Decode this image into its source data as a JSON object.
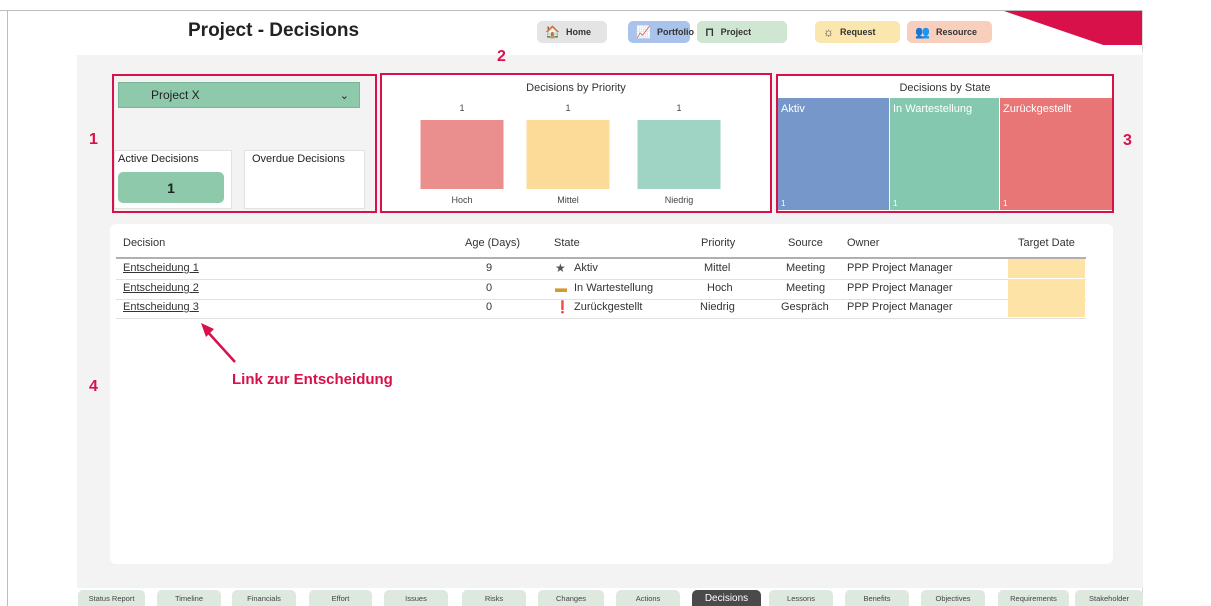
{
  "header": {
    "title": "Project - Decisions",
    "nav": [
      {
        "label": "Home",
        "icon": "home-icon",
        "glyph": "🏠",
        "color": "#e4e4e4"
      },
      {
        "label": "Portfolio",
        "icon": "portfolio-chart-icon",
        "glyph": "📈",
        "color": "#a9c3ec"
      },
      {
        "label": "Project",
        "icon": "gantt-icon",
        "glyph": "⊓",
        "color": "#cfe6d2"
      },
      {
        "label": "Request",
        "icon": "lightbulb-icon",
        "glyph": "☼",
        "color": "#fbe6ad"
      },
      {
        "label": "Resource",
        "icon": "people-icon",
        "glyph": "👥",
        "color": "#f8cfbd"
      }
    ],
    "accent_color": "#d8114a"
  },
  "annotations": {
    "numbers": [
      "1",
      "2",
      "3",
      "4"
    ],
    "link_note": "Link zur Entscheidung",
    "color": "#d8114a"
  },
  "filter": {
    "selected_project": "Project X",
    "chevron_icon": "chevron-down-icon"
  },
  "kpis": {
    "active_label": "Active Decisions",
    "active_value": "1",
    "overdue_label": "Overdue Decisions"
  },
  "priority_chart": {
    "title": "Decisions by Priority"
  },
  "chart_data": {
    "type": "bar",
    "title": "Decisions by Priority",
    "categories": [
      "Hoch",
      "Mittel",
      "Niedrig"
    ],
    "values": [
      1,
      1,
      1
    ],
    "colors": [
      "#ea8e8e",
      "#fcdb99",
      "#9fd3c3"
    ]
  },
  "state_chart": {
    "title": "Decisions by State",
    "states": [
      {
        "name": "Aktiv",
        "count": "1",
        "color": "#7597c9"
      },
      {
        "name": "In Wartestellung",
        "count": "1",
        "color": "#85c8b0"
      },
      {
        "name": "Zurückgestellt",
        "count": "1",
        "color": "#e87676"
      }
    ]
  },
  "table": {
    "headers": {
      "decision": "Decision",
      "age": "Age (Days)",
      "state": "State",
      "priority": "Priority",
      "source": "Source",
      "owner": "Owner",
      "target": "Target Date"
    },
    "rows": [
      {
        "decision": "Entscheidung 1",
        "age": "9",
        "state_icon": "star-icon",
        "state_glyph": "★",
        "state_color": "#555555",
        "state": "Aktiv",
        "priority": "Mittel",
        "source": "Meeting",
        "owner": "PPP Project Manager",
        "target": ""
      },
      {
        "decision": "Entscheidung 2",
        "age": "0",
        "state_icon": "dash-icon",
        "state_glyph": "▬",
        "state_color": "#d39a2d",
        "state": "In Wartestellung",
        "priority": "Hoch",
        "source": "Meeting",
        "owner": "PPP Project Manager",
        "target": ""
      },
      {
        "decision": "Entscheidung 3",
        "age": "0",
        "state_icon": "exclamation-icon",
        "state_glyph": "❗",
        "state_color": "#d39a2d",
        "state": "Zurückgestellt",
        "priority": "Niedrig",
        "source": "Gespräch",
        "owner": "PPP Project Manager",
        "target": ""
      }
    ]
  },
  "tabs": [
    {
      "label": "Status Report"
    },
    {
      "label": "Timeline"
    },
    {
      "label": "Financials"
    },
    {
      "label": "Effort"
    },
    {
      "label": "Issues"
    },
    {
      "label": "Risks"
    },
    {
      "label": "Changes"
    },
    {
      "label": "Actions"
    },
    {
      "label": "Decisions",
      "active": true
    },
    {
      "label": "Lessons"
    },
    {
      "label": "Benefits"
    },
    {
      "label": "Objectives"
    },
    {
      "label": "Requirements"
    },
    {
      "label": "Stakeholder"
    }
  ]
}
